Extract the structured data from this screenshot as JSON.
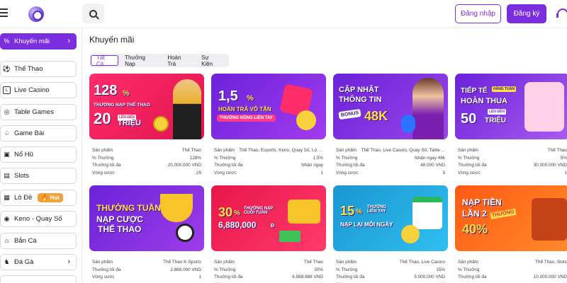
{
  "header": {
    "login_label": "Đăng nhập",
    "register_label": "Đăng ký"
  },
  "sidebar": {
    "items": [
      {
        "label": "Khuyến mãi",
        "icon": "percent-icon",
        "active": true
      },
      {
        "label": "Thể Thao",
        "icon": "soccer-ball-icon"
      },
      {
        "label": "Live Casino",
        "icon": "live-icon"
      },
      {
        "label": "Table Games",
        "icon": "chip-icon"
      },
      {
        "label": "Game Bài",
        "icon": "spade-icon"
      },
      {
        "label": "Nổ Hũ",
        "icon": "slot-icon"
      },
      {
        "label": "Slots",
        "icon": "slot-machine-icon"
      },
      {
        "label": "Lô Đề",
        "icon": "lottery-icon",
        "badge": "Hot"
      },
      {
        "label": "Keno - Quay Số",
        "icon": "keno-icon"
      },
      {
        "label": "Bắn Cá",
        "icon": "fish-icon"
      },
      {
        "label": "Đá Gà",
        "icon": "rooster-icon"
      }
    ]
  },
  "main": {
    "title": "Khuyến mãi",
    "tabs": [
      "Tất Cả",
      "Thưởng Nạp",
      "Hoàn Trả",
      "Sự Kiện"
    ]
  },
  "labels": {
    "product": "Sản phẩm",
    "percent": "% Thưởng",
    "max_bonus": "Thưởng tối đa",
    "rounds": "Vòng cược"
  },
  "promos": [
    {
      "line1": "128",
      "unit": "%",
      "line2": "THƯỞNG NẠP THỂ THAO",
      "line3": "20",
      "line4": "TRIỆU",
      "tag": "LÊN ĐẾN",
      "product": "Thể Thao",
      "percent": "128%",
      "max": "20.000.000 VND",
      "rounds": "25",
      "colors": [
        "#ff3b6b",
        "#ff2d55"
      ]
    },
    {
      "line1": "1,5",
      "unit": "%",
      "line2": "HOÀN TRẢ VÔ TẬN",
      "line3": "THƯỞNG NỒNG LIỀN TAY",
      "product": "Thể Thao, Esports, Keno, Quay Số, Lô Đề",
      "percent": "1,5%",
      "max": "Nhận ngay",
      "rounds": "1",
      "colors": [
        "#7b2ee0",
        "#a23cf0"
      ]
    },
    {
      "line1": "CẬP NHẬT",
      "line2": "THÔNG TIN",
      "line3": "BONUS",
      "line4": "48K",
      "product": "Thể Thao, Live Casino, Quay Số, Table ...",
      "percent": "Nhận ngay 48k",
      "max": "48.000 VND",
      "rounds": "5",
      "colors": [
        "#7b2ee0",
        "#9a46e8"
      ]
    },
    {
      "line1": "TIẾP TẾ",
      "line2": "HOÀN THUA",
      "line3": "50",
      "line4": "TRIỆU",
      "tag": "HẰNG TUẦN",
      "tag2": "LÊN ĐẾN",
      "product": "Thể Thao",
      "percent": "5%",
      "max": "30.000.000 VND",
      "rounds": "1",
      "colors": [
        "#7b2ee0",
        "#a85cf0"
      ]
    },
    {
      "line1": "THƯỞNG TUẦN",
      "line2": "NẠP CƯỢC",
      "line3": "THỂ THAO",
      "product": "Thể Thao K-Sports",
      "percent": "",
      "max": "2.888.000 VND",
      "rounds": "1",
      "colors": [
        "#7b2ee0",
        "#9d3ee8"
      ]
    },
    {
      "line1": "30",
      "unit": "%",
      "line2": "THƯỞNG NẠP CUỐI TUẦN",
      "line3": "6,880,000",
      "line4": "Đ",
      "product": "Thể Thao",
      "percent": "30%",
      "max": "6.888.888 VND",
      "rounds": "1",
      "colors": [
        "#e8164a",
        "#ff3b6b"
      ]
    },
    {
      "line1": "15",
      "unit": "%",
      "line2": "THƯỞNG LIỀN TAY",
      "line3": "NẠP LẠI MỖI NGÀY",
      "product": "Thể Thao, Live Casino",
      "percent": "15%",
      "max": "5.000.000 VND",
      "rounds": "1",
      "colors": [
        "#1aa0d6",
        "#2ab8e8"
      ]
    },
    {
      "line1": "NẠP TIỀN",
      "line2": "LẦN 2",
      "line3": "40%",
      "tag": "THƯỞNG",
      "product": "Thể Thao, Slots",
      "percent": "",
      "max": "10.000.000 VND",
      "rounds": "",
      "colors": [
        "#ff6a1a",
        "#ff8a2a"
      ]
    }
  ]
}
